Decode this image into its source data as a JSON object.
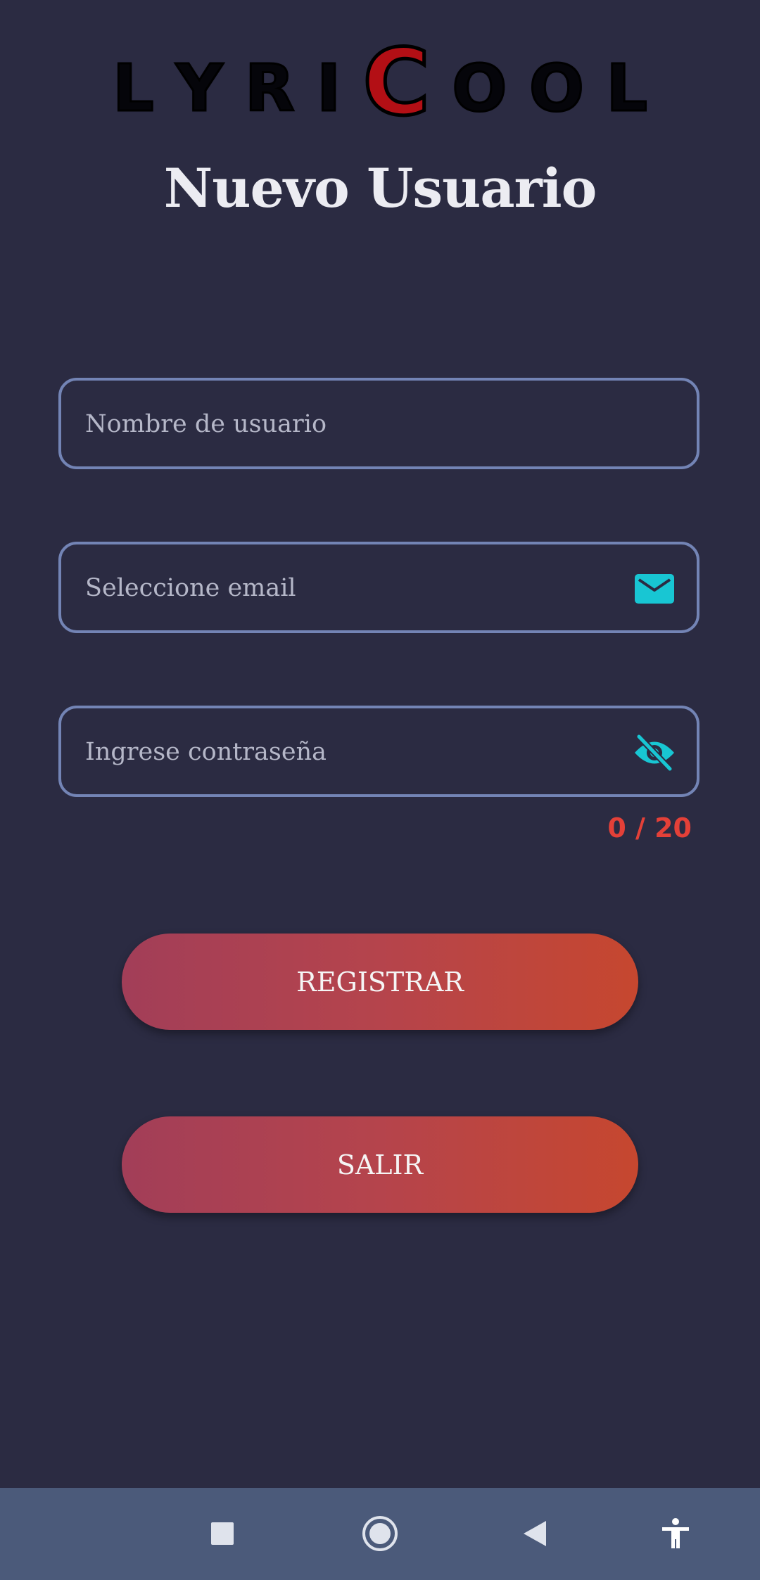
{
  "app": {
    "logo_letters": [
      "L",
      "Y",
      "R",
      "I",
      "C",
      "O",
      "O",
      "L"
    ]
  },
  "page": {
    "title": "Nuevo Usuario"
  },
  "form": {
    "username_placeholder": "Nombre de usuario",
    "email_placeholder": "Seleccione email",
    "password_placeholder": "Ingrese contraseña",
    "password_counter": "0 / 20",
    "email_icon": "mail-icon",
    "password_icon": "visibility-off-icon"
  },
  "buttons": {
    "register_label": "REGISTRAR",
    "exit_label": "SALIR"
  },
  "navbar": {
    "icons": [
      "recent-apps-icon",
      "home-icon",
      "back-icon",
      "accessibility-icon"
    ]
  },
  "colors": {
    "background": "#2b2b42",
    "field_border": "#7384b5",
    "icon_accent": "#18c6d3",
    "counter": "#e44038",
    "button_gradient_start": "#a23e58",
    "button_gradient_end": "#c6472f",
    "navbar": "#4b5a7a"
  }
}
